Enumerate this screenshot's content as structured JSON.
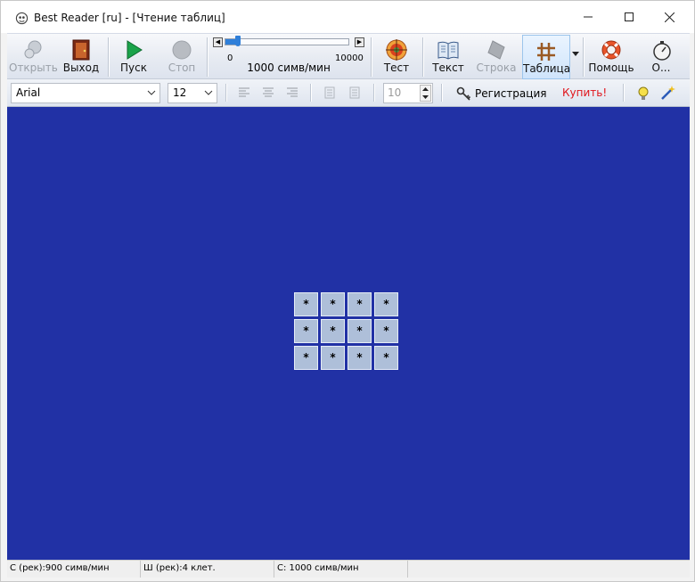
{
  "window": {
    "title": "Best Reader [ru] - [Чтение таблиц]",
    "controls": {
      "minimize_icon": "minimize-icon",
      "maximize_icon": "maximize-icon",
      "close_icon": "close-icon"
    }
  },
  "toolbar": {
    "open_label": "Открыть",
    "exit_label": "Выход",
    "start_label": "Пуск",
    "stop_label": "Стоп",
    "test_label": "Тест",
    "text_label": "Текст",
    "line_label": "Строка",
    "table_label": "Таблица",
    "help_label": "Помощь",
    "about_label": "О...",
    "active_mode": "Таблица"
  },
  "speed": {
    "min": "0",
    "max": "10000",
    "current": "1000 симв/мин",
    "value": 1000,
    "fraction": 0.1
  },
  "format": {
    "font_name": "Arial",
    "font_size": "12",
    "line_count": "10",
    "register_label": "Регистрация",
    "buy_label": "Купить!"
  },
  "table": {
    "rows": [
      [
        "*",
        "*",
        "*",
        "*"
      ],
      [
        "*",
        "*",
        "*",
        "*"
      ],
      [
        "*",
        "*",
        "*",
        "*"
      ]
    ]
  },
  "status": {
    "recommended_speed": "С (рек):900 симв/мин",
    "recommended_width": "Ш (рек):4 клет.",
    "current_speed": "С: 1000 симв/мин"
  },
  "colors": {
    "workspace": "#2131a5",
    "cell": "#aebfd9",
    "buy_link": "#e0141b",
    "slider": "#2f7fd9"
  }
}
